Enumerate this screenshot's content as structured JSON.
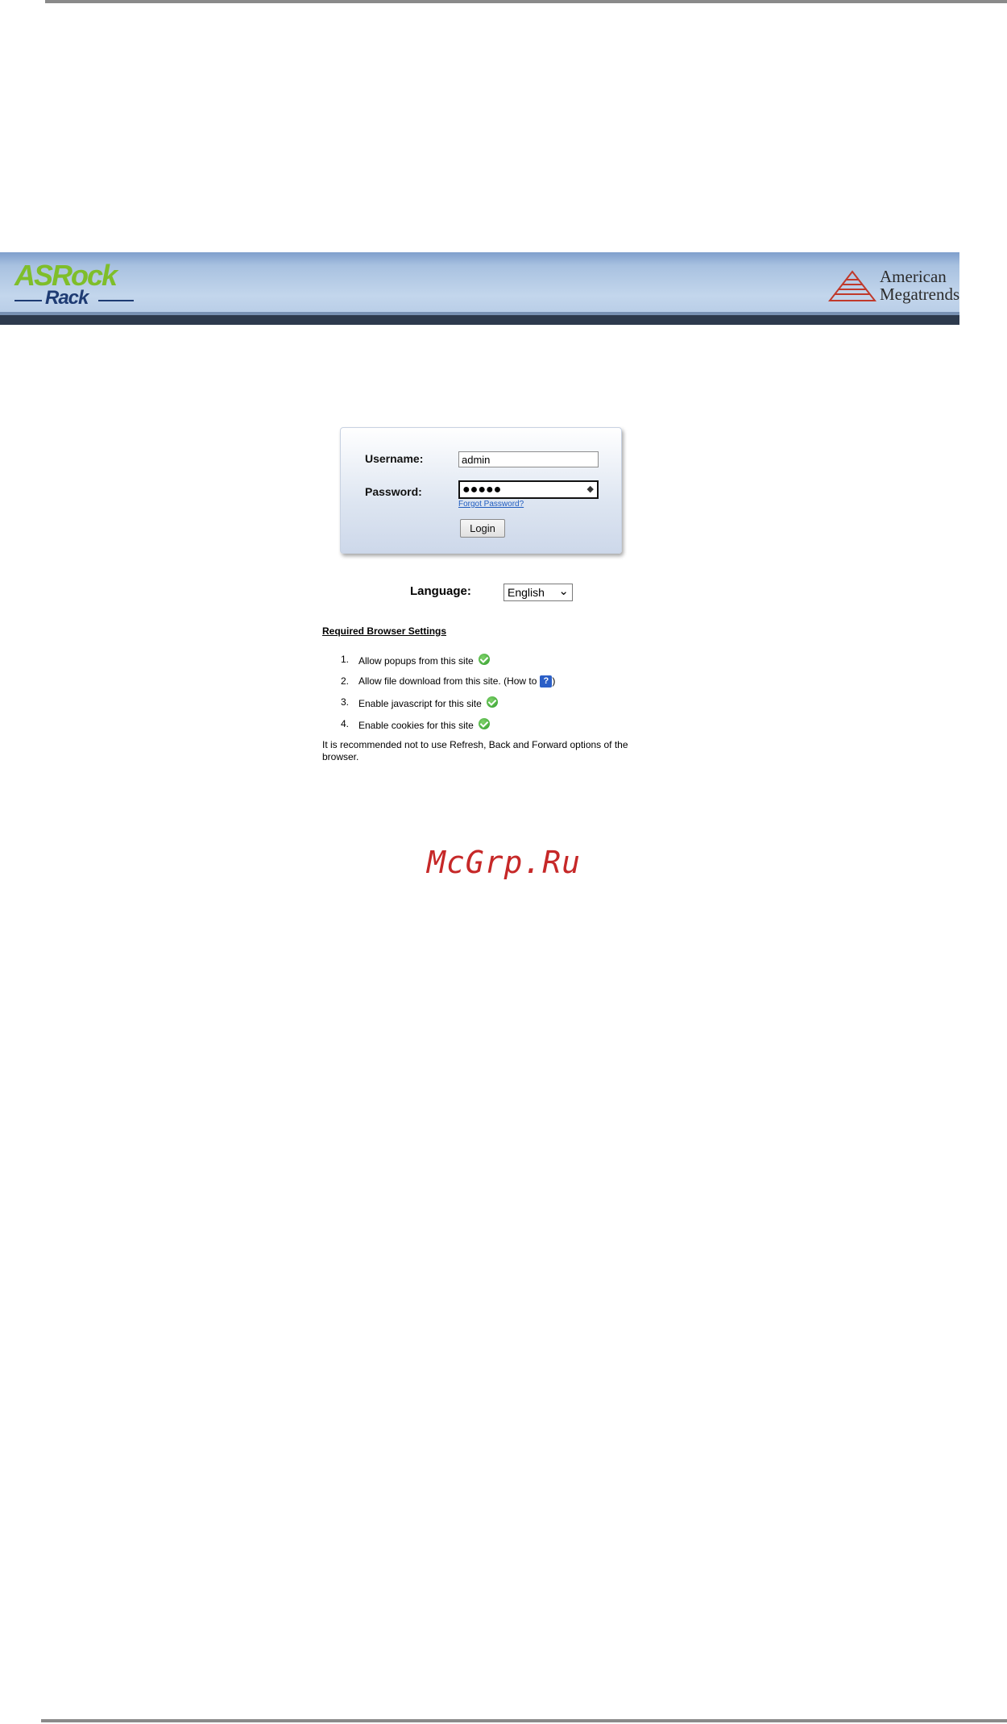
{
  "header": {
    "left_logo": {
      "line1": "ASRock",
      "line2": "Rack"
    },
    "right_logo": {
      "line1": "American",
      "line2": "Megatrends"
    }
  },
  "login": {
    "username_label": "Username:",
    "username_value": "admin",
    "password_label": "Password:",
    "password_masked": "●●●●●",
    "forgot_password_link": "Forgot Password?",
    "login_button": "Login"
  },
  "language": {
    "label": "Language:",
    "selected": "English"
  },
  "browser_settings": {
    "title": "Required Browser Settings",
    "items": [
      {
        "num": "1.",
        "text": "Allow popups from this site",
        "status": "check-icon"
      },
      {
        "num": "2.",
        "text": "Allow file download from this site. (How to",
        "suffix": ")",
        "status": "help-icon",
        "help_glyph": "?"
      },
      {
        "num": "3.",
        "text": "Enable javascript for this site",
        "status": "check-icon"
      },
      {
        "num": "4.",
        "text": "Enable cookies for this site",
        "status": "check-icon"
      }
    ],
    "note": "It is recommended not to use Refresh, Back and Forward options of the browser."
  },
  "watermark": "McGrp.Ru",
  "colors": {
    "brand_green": "#7fbe2a",
    "brand_navy": "#1e3b73",
    "link_blue": "#1e5bbf",
    "watermark_red": "#c62828"
  }
}
